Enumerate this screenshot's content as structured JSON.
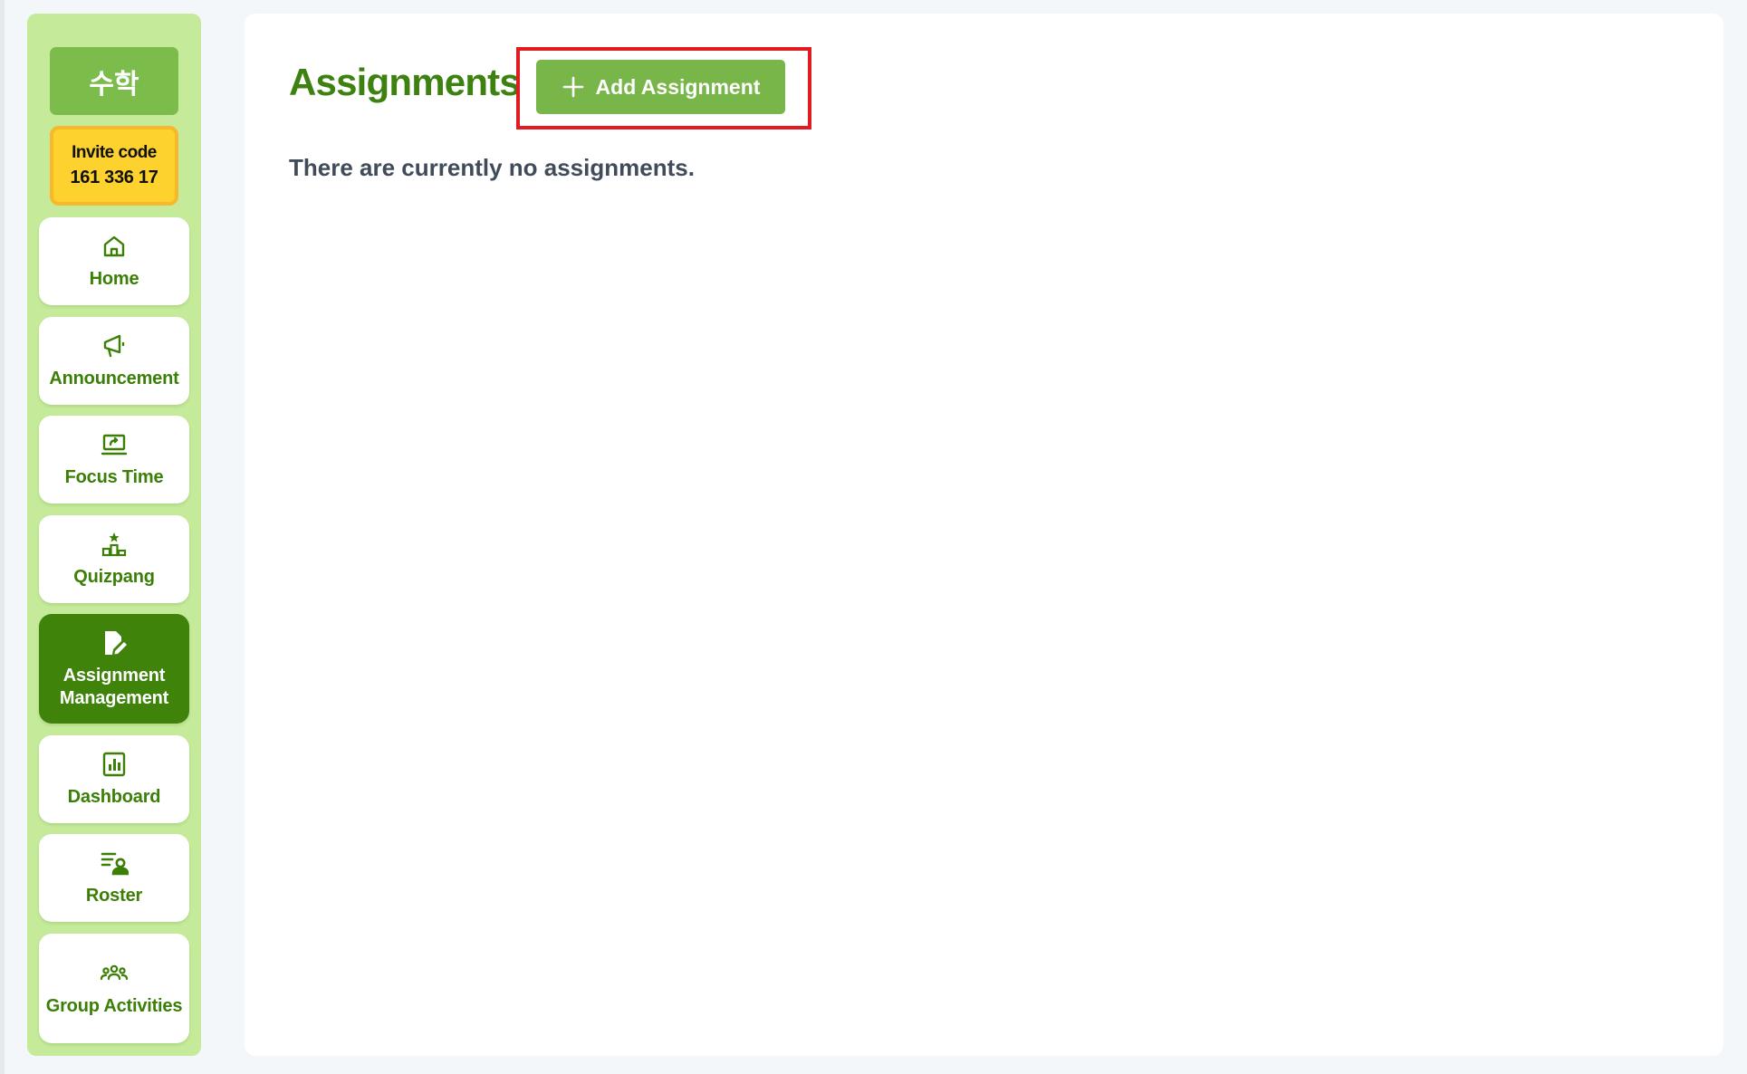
{
  "sidebar": {
    "class_name": "수학",
    "invite": {
      "label": "Invite code",
      "code": "161 336 17"
    },
    "items": [
      {
        "label": "Home",
        "icon": "home-icon"
      },
      {
        "label": "Announcement",
        "icon": "megaphone-icon"
      },
      {
        "label": "Focus Time",
        "icon": "laptop-icon"
      },
      {
        "label": "Quizpang",
        "icon": "podium-star-icon"
      },
      {
        "label": "Assignment Management",
        "icon": "edit-document-icon",
        "active": true
      },
      {
        "label": "Dashboard",
        "icon": "bar-chart-icon"
      },
      {
        "label": "Roster",
        "icon": "roster-list-icon"
      },
      {
        "label": "Group Activities",
        "icon": "group-icon"
      }
    ]
  },
  "main": {
    "title": "Assignments",
    "add_button_label": "Add Assignment",
    "empty_message": "There are currently no assignments."
  },
  "colors": {
    "sidebar_bg": "#c5eb9a",
    "accent_green": "#3f830a",
    "button_green": "#79b64a",
    "invite_yellow": "#fed22e",
    "highlight_red": "#e01b22"
  }
}
